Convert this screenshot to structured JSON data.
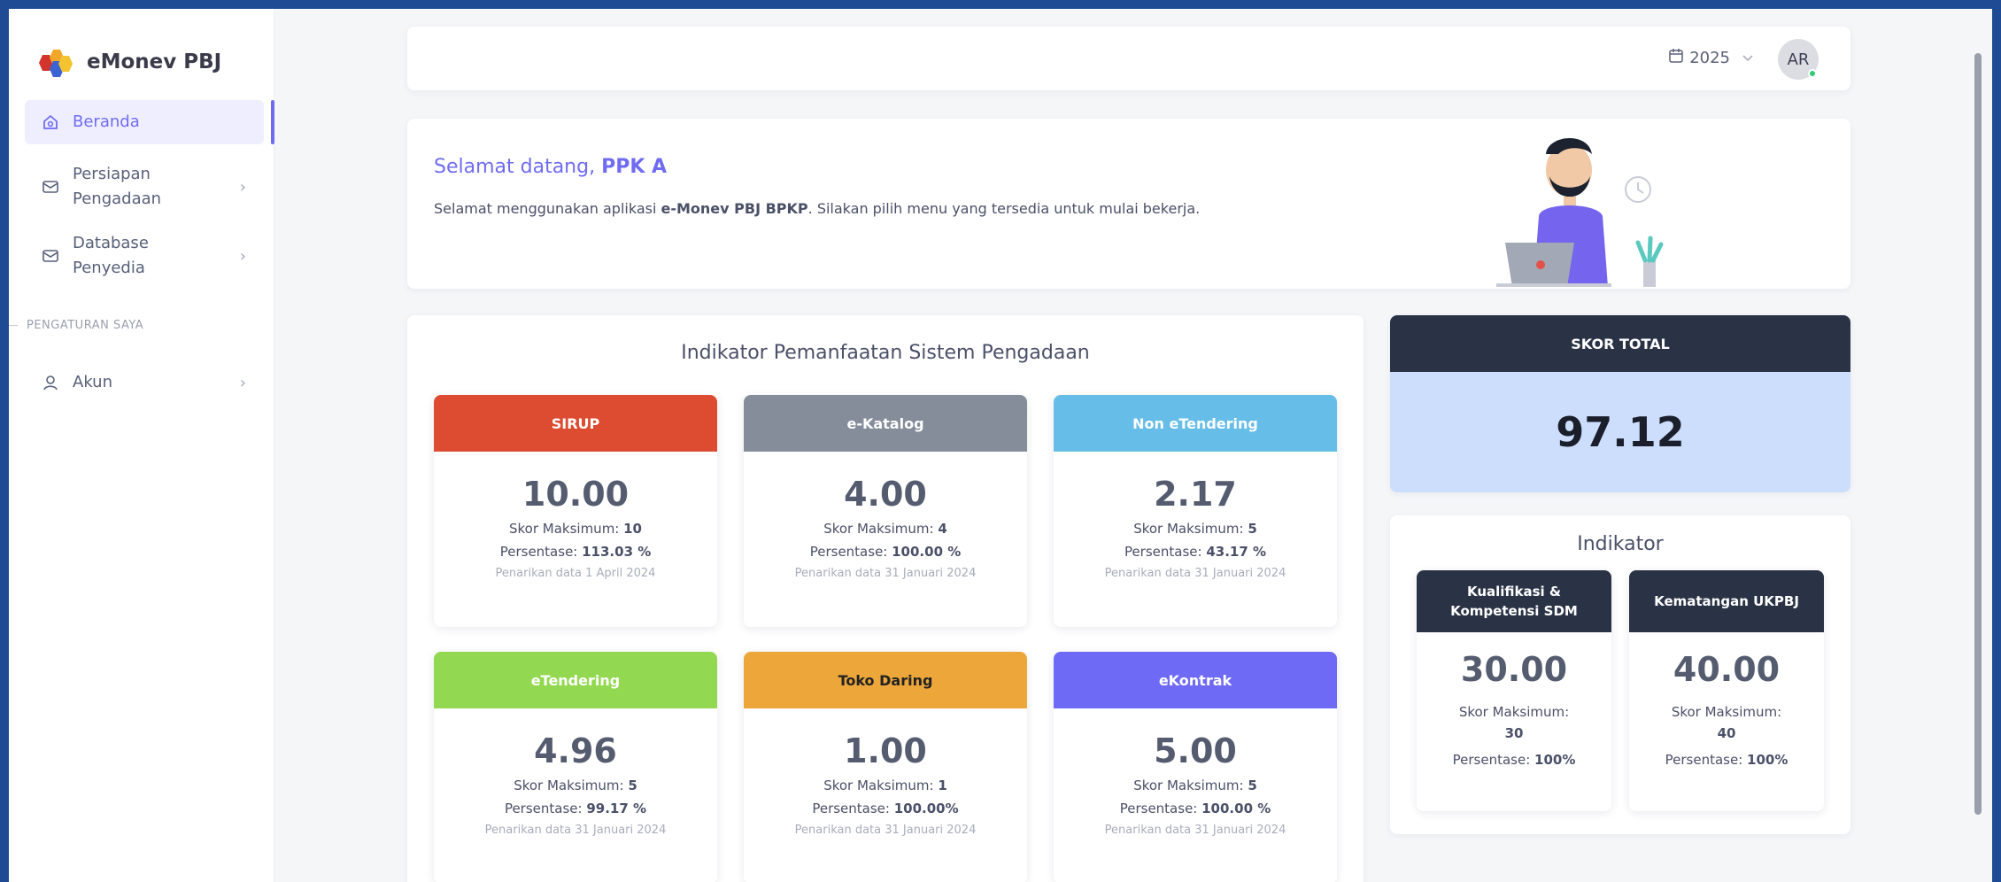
{
  "app": {
    "name": "eMonev PBJ"
  },
  "sidebar": {
    "items": [
      {
        "label": "Beranda"
      },
      {
        "label_line1": "Persiapan",
        "label_line2": "Pengadaan"
      },
      {
        "label_line1": "Database",
        "label_line2": "Penyedia"
      }
    ],
    "section_label": "PENGATURAN SAYA",
    "account_label": "Akun",
    "chevron": "›"
  },
  "topbar": {
    "year": "2025",
    "avatar_initials": "AR"
  },
  "welcome": {
    "greeting": "Selamat datang, ",
    "user": "PPK A",
    "text_before": "Selamat menggunakan aplikasi ",
    "app_bold": "e-Monev PBJ BPKP",
    "text_after": ". Silakan pilih menu yang tersedia untuk mulai bekerja."
  },
  "indicators": {
    "title": "Indikator Pemanfaatan Sistem Pengadaan",
    "max_label": "Skor Maksimum: ",
    "pct_label": "Persentase: ",
    "cards": [
      {
        "name": "SIRUP",
        "color": "#dd4b30",
        "score": "10.00",
        "max": "10",
        "pct": "113.03 %",
        "note": "Penarikan data 1 April 2024"
      },
      {
        "name": "e-Katalog",
        "color": "#858d9b",
        "score": "4.00",
        "max": "4",
        "pct": "100.00 %",
        "note": "Penarikan data 31 Januari 2024"
      },
      {
        "name": "Non eTendering",
        "color": "#66bde7",
        "score": "2.17",
        "max": "5",
        "pct": "43.17 %",
        "note": "Penarikan data 31 Januari 2024"
      },
      {
        "name": "eTendering",
        "color": "#92d850",
        "score": "4.96",
        "max": "5",
        "pct": "99.17 %",
        "note": "Penarikan data 31 Januari 2024"
      },
      {
        "name": "Toko Daring",
        "color": "#eca63a",
        "score": "1.00",
        "max": "1",
        "pct": "100.00%",
        "note": "Penarikan data 31 Januari 2024"
      },
      {
        "name": "eKontrak",
        "color": "#6f6af5",
        "score": "5.00",
        "max": "5",
        "pct": "100.00 %",
        "note": "Penarikan data 31 Januari 2024"
      }
    ]
  },
  "skor_total": {
    "label": "SKOR TOTAL",
    "value": "97.12"
  },
  "indikator": {
    "title": "Indikator",
    "max_label": "Skor Maksimum:",
    "pct_label": "Persentase: ",
    "cards": [
      {
        "name": "Kualifikasi & Kompetensi SDM",
        "score": "30.00",
        "max": "30",
        "pct": "100%"
      },
      {
        "name": "Kematangan UKPBJ",
        "score": "40.00",
        "max": "40",
        "pct": "100%"
      }
    ]
  }
}
